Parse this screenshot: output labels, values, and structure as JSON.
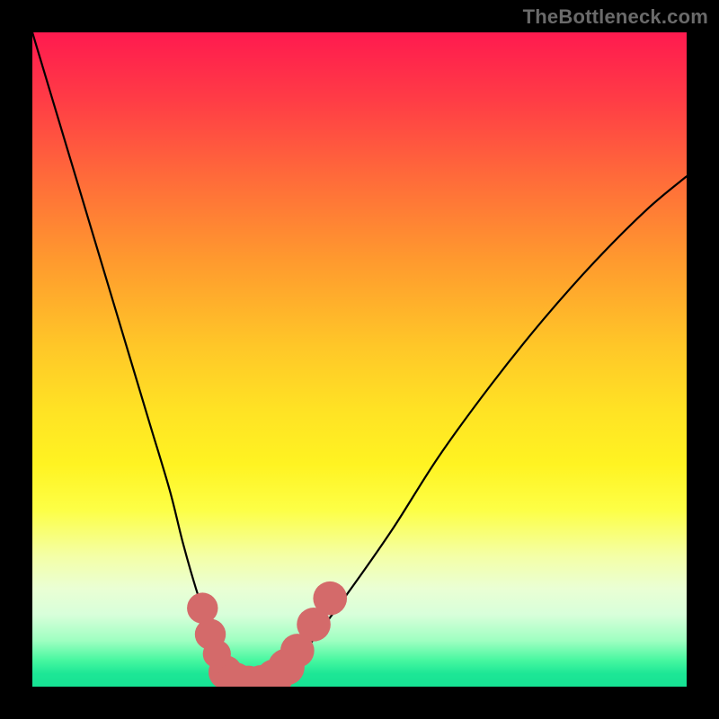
{
  "watermark": "TheBottleneck.com",
  "chart_data": {
    "type": "line",
    "title": "",
    "xlabel": "",
    "ylabel": "",
    "xlim": [
      0,
      100
    ],
    "ylim": [
      0,
      100
    ],
    "series": [
      {
        "name": "bottleneck-curve",
        "x": [
          0,
          3,
          6,
          9,
          12,
          15,
          18,
          21,
          23,
          25,
          27,
          29,
          31,
          33,
          35,
          38,
          42,
          48,
          55,
          62,
          70,
          78,
          86,
          94,
          100
        ],
        "y": [
          100,
          90,
          80,
          70,
          60,
          50,
          40,
          30,
          22,
          15,
          9,
          4,
          1,
          0,
          0,
          2,
          6,
          14,
          24,
          35,
          46,
          56,
          65,
          73,
          78
        ]
      }
    ],
    "markers": {
      "name": "highlight-dots",
      "color": "#d46a6a",
      "points": [
        {
          "x": 26.0,
          "y": 12.0,
          "r": 1.4
        },
        {
          "x": 27.2,
          "y": 8.0,
          "r": 1.4
        },
        {
          "x": 28.2,
          "y": 5.0,
          "r": 1.2
        },
        {
          "x": 29.5,
          "y": 2.2,
          "r": 1.6
        },
        {
          "x": 31.0,
          "y": 0.9,
          "r": 1.8
        },
        {
          "x": 33.0,
          "y": 0.4,
          "r": 1.8
        },
        {
          "x": 35.0,
          "y": 0.5,
          "r": 1.8
        },
        {
          "x": 37.0,
          "y": 1.4,
          "r": 1.8
        },
        {
          "x": 38.8,
          "y": 3.0,
          "r": 1.8
        },
        {
          "x": 40.5,
          "y": 5.5,
          "r": 1.6
        },
        {
          "x": 43.0,
          "y": 9.5,
          "r": 1.6
        },
        {
          "x": 45.5,
          "y": 13.5,
          "r": 1.6
        }
      ]
    }
  }
}
